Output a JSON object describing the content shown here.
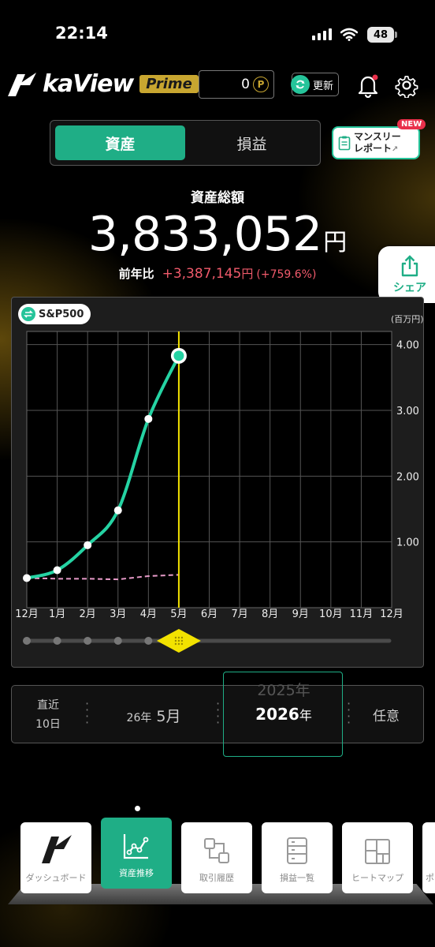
{
  "status_bar": {
    "time": "22:14",
    "battery": "48"
  },
  "header": {
    "logo": "kaView",
    "badge": "Prime",
    "points": "0",
    "points_symbol": "P",
    "refresh_label": "更新"
  },
  "tabs": [
    {
      "label": "資産",
      "active": true
    },
    {
      "label": "損益",
      "active": false
    }
  ],
  "monthly_report": {
    "line1": "マンスリー",
    "line2": "レポート",
    "badge": "NEW"
  },
  "summary": {
    "title": "資産総額",
    "amount": "3,833,052",
    "unit": "円",
    "diff_label": "前年比",
    "diff_value": "+3,387,145",
    "diff_unit": "円",
    "diff_percent": "(+759.6%)"
  },
  "share_label": "シェア",
  "chart": {
    "benchmark_label": "S&P500",
    "y_unit": "(百万円)"
  },
  "chart_data": {
    "type": "line",
    "categories": [
      "12月",
      "1月",
      "2月",
      "3月",
      "4月",
      "5月",
      "6月",
      "7月",
      "8月",
      "9月",
      "10月",
      "11月",
      "12月"
    ],
    "series": [
      {
        "values": [
          0.45,
          0.57,
          0.95,
          1.48,
          2.87,
          3.83
        ]
      },
      {
        "values": [
          0.45,
          0.44,
          0.44,
          0.43,
          0.48,
          0.5
        ]
      }
    ],
    "yticks": [
      "1.00",
      "2.00",
      "3.00",
      "4.00"
    ],
    "ylim": [
      0,
      4.2
    ],
    "current_index": 5,
    "colors": {
      "asset": "#25d3a3",
      "benchmark": "#e89bc9",
      "marker": "#f2e200"
    }
  },
  "period": {
    "recent_line1": "直近",
    "recent_line2": "10日",
    "month_year": "26年",
    "month": "5月",
    "year_prev": "2025年",
    "year_num": "2026",
    "year_unit": "年",
    "any": "任意"
  },
  "nav": [
    {
      "label": "ダッシュボード",
      "icon": "dashboard-icon"
    },
    {
      "label": "資産推移",
      "icon": "asset-trend-icon",
      "active": true
    },
    {
      "label": "取引履歴",
      "icon": "trade-history-icon"
    },
    {
      "label": "損益一覧",
      "icon": "pnl-list-icon"
    },
    {
      "label": "ヒートマップ",
      "icon": "heatmap-icon"
    },
    {
      "label": "ポ",
      "icon": "portfolio-icon"
    }
  ]
}
